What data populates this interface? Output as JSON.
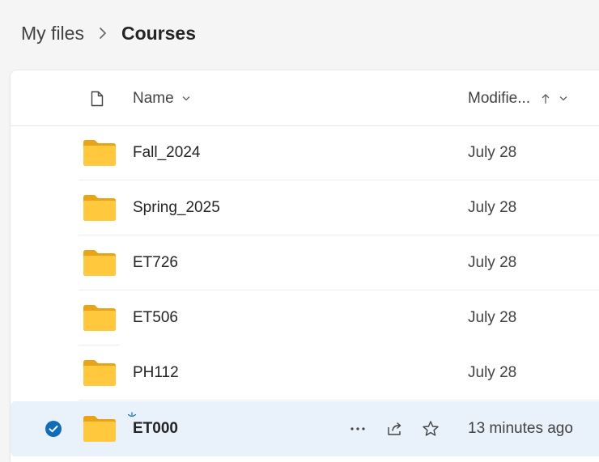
{
  "breadcrumb": {
    "root": "My files",
    "current": "Courses"
  },
  "header": {
    "name_label": "Name",
    "modified_label": "Modifie..."
  },
  "rows": [
    {
      "name": "Fall_2024",
      "modified": "July 28"
    },
    {
      "name": "Spring_2025",
      "modified": "July 28"
    },
    {
      "name": "ET726",
      "modified": "July 28"
    },
    {
      "name": "ET506",
      "modified": "July 28"
    },
    {
      "name": "PH112",
      "modified": "July 28"
    },
    {
      "name": "ET000",
      "modified": "13 minutes ago"
    }
  ],
  "colors": {
    "accent": "#0f6cbd",
    "folder": "#ffc83d",
    "selected_row": "#e9f1fb"
  },
  "icons": [
    "chevron-right-icon",
    "file-icon",
    "chevron-down-icon",
    "arrow-up-icon",
    "folder-icon",
    "checkmark-circle-icon",
    "new-badge-icon",
    "more-icon",
    "share-icon",
    "star-icon"
  ]
}
